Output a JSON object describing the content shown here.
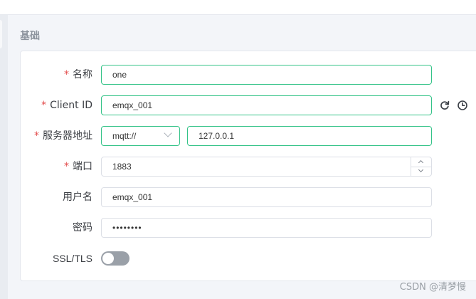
{
  "section": {
    "title": "基础"
  },
  "form": {
    "required_mark": "*",
    "name": {
      "label": "名称",
      "value": "one"
    },
    "client_id": {
      "label": "Client ID",
      "value": "emqx_001"
    },
    "server": {
      "label": "服务器地址",
      "protocol": "mqtt://",
      "host": "127.0.0.1"
    },
    "port": {
      "label": "端口",
      "value": "1883"
    },
    "username": {
      "label": "用户名",
      "value": "emqx_001"
    },
    "password": {
      "label": "密码",
      "value": "••••••••"
    },
    "ssl": {
      "label": "SSL/TLS",
      "enabled": false
    }
  },
  "icons": {
    "refresh": "refresh-icon",
    "history": "clock-icon"
  },
  "colors": {
    "accent": "#34c388",
    "required": "#e34d4d",
    "toggle_off": "#9aa0a8"
  },
  "watermark": "CSDN @清梦慢"
}
